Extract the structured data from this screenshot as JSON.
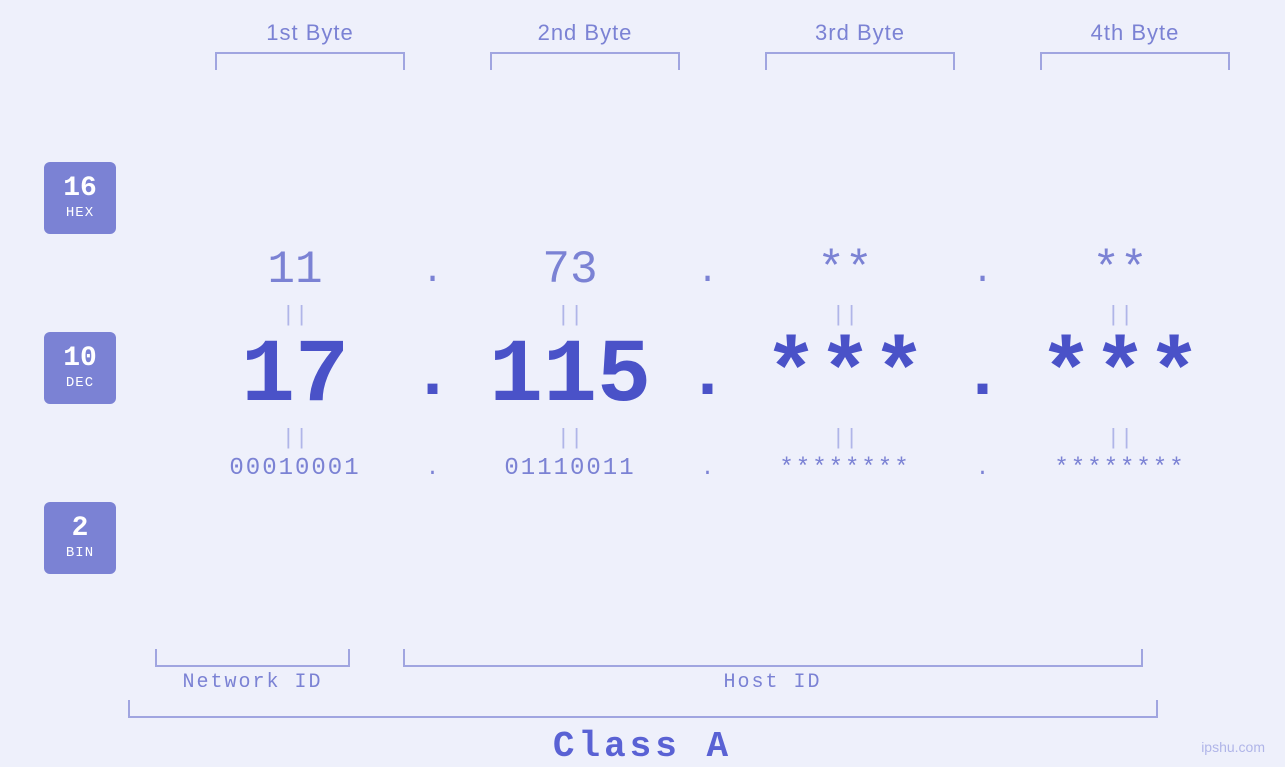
{
  "headers": {
    "byte1": "1st Byte",
    "byte2": "2nd Byte",
    "byte3": "3rd Byte",
    "byte4": "4th Byte"
  },
  "badges": {
    "hex": {
      "num": "16",
      "label": "HEX"
    },
    "dec": {
      "num": "10",
      "label": "DEC"
    },
    "bin": {
      "num": "2",
      "label": "BIN"
    }
  },
  "hex_row": {
    "b1": "11",
    "b2": "73",
    "b3": "**",
    "b4": "**",
    "dots": [
      ".",
      ".",
      "."
    ]
  },
  "dec_row": {
    "b1": "17",
    "b2": "115.",
    "b3": "***.",
    "b4": "***",
    "dots": [
      ".",
      ".",
      "."
    ]
  },
  "bin_row": {
    "b1": "00010001",
    "b2": "01110011",
    "b3": "********",
    "b4": "********",
    "dots": [
      ".",
      ".",
      "."
    ]
  },
  "labels": {
    "network_id": "Network ID",
    "host_id": "Host ID",
    "class": "Class A"
  },
  "watermark": "ipshu.com",
  "equals": "||"
}
